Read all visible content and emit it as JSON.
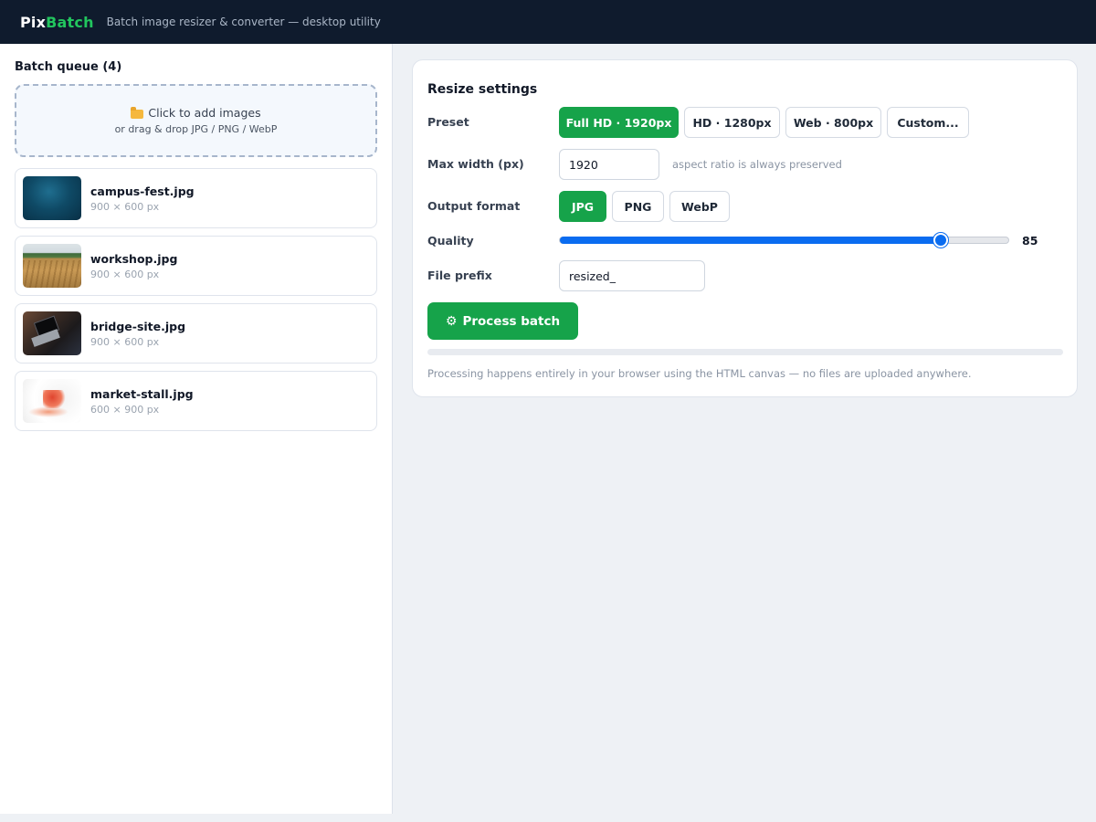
{
  "header": {
    "brand_part1": "Pix",
    "brand_part2": "Batch",
    "tagline": "Batch image resizer & converter — desktop utility"
  },
  "queue": {
    "title": "Batch queue (4)",
    "dropzone_main": "Click to add images",
    "dropzone_sub": "or drag & drop JPG / PNG / WebP",
    "files": [
      {
        "name": "campus-fest.jpg",
        "dims": "900 × 600 px"
      },
      {
        "name": "workshop.jpg",
        "dims": "900 × 600 px"
      },
      {
        "name": "bridge-site.jpg",
        "dims": "900 × 600 px"
      },
      {
        "name": "market-stall.jpg",
        "dims": "600 × 900 px"
      }
    ]
  },
  "settings": {
    "title": "Resize settings",
    "preset_label": "Preset",
    "presets": [
      "Full HD · 1920px",
      "HD · 1280px",
      "Web · 800px",
      "Custom..."
    ],
    "preset_selected": "Full HD · 1920px",
    "max_width_label": "Max width (px)",
    "max_width_value": "1920",
    "max_width_hint": "aspect ratio is always preserved",
    "format_label": "Output format",
    "formats": [
      "JPG",
      "PNG",
      "WebP"
    ],
    "format_selected": "JPG",
    "quality_label": "Quality",
    "quality_value": "85",
    "quality_min": 0,
    "quality_max": 100,
    "quality_level": 85,
    "prefix_label": "File prefix",
    "prefix_value": "resized_",
    "process_label": "Process batch",
    "progress_percent": 0,
    "footnote": "Processing happens entirely in your browser using the HTML canvas — no files are uploaded anywhere."
  },
  "colors": {
    "header_bg": "#0f1b2d",
    "brand_accent": "#22c55e",
    "primary_green": "#16a34a",
    "slider_blue": "#0a6cf0"
  },
  "icons": {
    "dropzone": "folder-icon",
    "process": "gear-icon"
  }
}
